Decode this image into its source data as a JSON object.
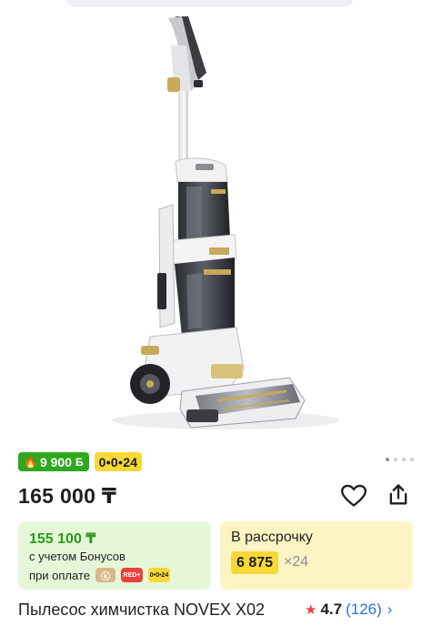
{
  "badges": {
    "bonus_amount": "9 900",
    "bonus_icon": "fire-icon",
    "bonus_currency": "Б",
    "installment_label": "0•0•24"
  },
  "gallery": {
    "total_images": 4,
    "active_index": 0
  },
  "price": {
    "value": "165 000 ₸"
  },
  "actions": {
    "favorite_icon": "heart-icon",
    "share_icon": "share-icon"
  },
  "bonus_card": {
    "price": "155 100 ₸",
    "line1": "с учетом Бонусов",
    "line2": "при оплате",
    "icons": [
      "kaspi-icon",
      "red-plus-icon",
      "installment-icon"
    ],
    "red_label": "RED+",
    "inst_label": "0•0•24"
  },
  "installment_card": {
    "title": "В рассрочку",
    "amount": "6 875",
    "months": "×24"
  },
  "product": {
    "title": "Пылесос химчистка NOVEX X02",
    "rating": "4.7",
    "reviews": "(126)"
  },
  "colors": {
    "bonus_green": "#2fa81f",
    "installment_yellow": "#f7d838",
    "bonus_card_bg": "#e6f7d9",
    "install_card_bg": "#fdf4c4",
    "star_red": "#e8423c",
    "link_blue": "#2d6fd6"
  }
}
